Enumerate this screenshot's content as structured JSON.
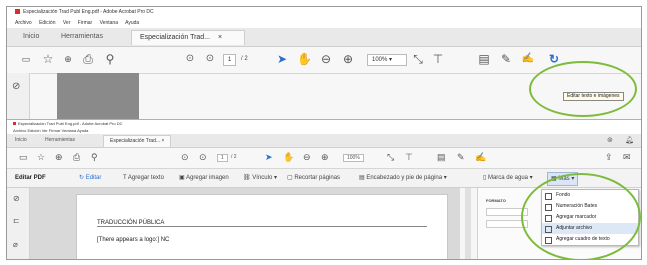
{
  "top_window": {
    "title": "Especialización Trad Publ Eng.pdf - Adobe Acrobat Pro DC",
    "menu": [
      "Archivo",
      "Edición",
      "Ver",
      "Firmar",
      "Ventana",
      "Ayuda"
    ],
    "tabs": [
      "Inicio",
      "Herramientas",
      "Especialización Trad..."
    ],
    "page_current": "1",
    "page_total": "/ 2",
    "tooltip": "Editar texto e imágenes"
  },
  "bottom_window": {
    "title": "Especialización Trad Publ Eng.pdf - Adobe Acrobat Pro DC",
    "menu": [
      "Archivo",
      "Edición",
      "Ver",
      "Firmar",
      "Ventana",
      "Ayuda"
    ],
    "tabs": [
      "Inicio",
      "Herramientas",
      "Especialización Trad..."
    ],
    "page_current": "1",
    "page_total": "/ 2",
    "zoom": "100%",
    "edit_bar": {
      "label": "Editar PDF",
      "items": [
        "Editar",
        "Agregar texto",
        "Agregar imagen",
        "Vínculo",
        "Recortar páginas",
        "Encabezado y pie de página",
        "Marca de agua",
        "Más"
      ]
    },
    "menu_items": [
      "Fondo",
      "Numeración Bates",
      "Agregar marcador",
      "Adjuntar archivo",
      "Agregar cuadro de texto"
    ],
    "right_panel_label": "FORMATO",
    "document": {
      "heading": "TRADUCCIÓN PÚBLICA",
      "line1": "[There appears a logo:] NC"
    }
  },
  "colors": {
    "highlight_ellipse": "#7dbb3c",
    "pdf_red": "#d4302b",
    "acrobat_blue": "#2a6fd1"
  }
}
